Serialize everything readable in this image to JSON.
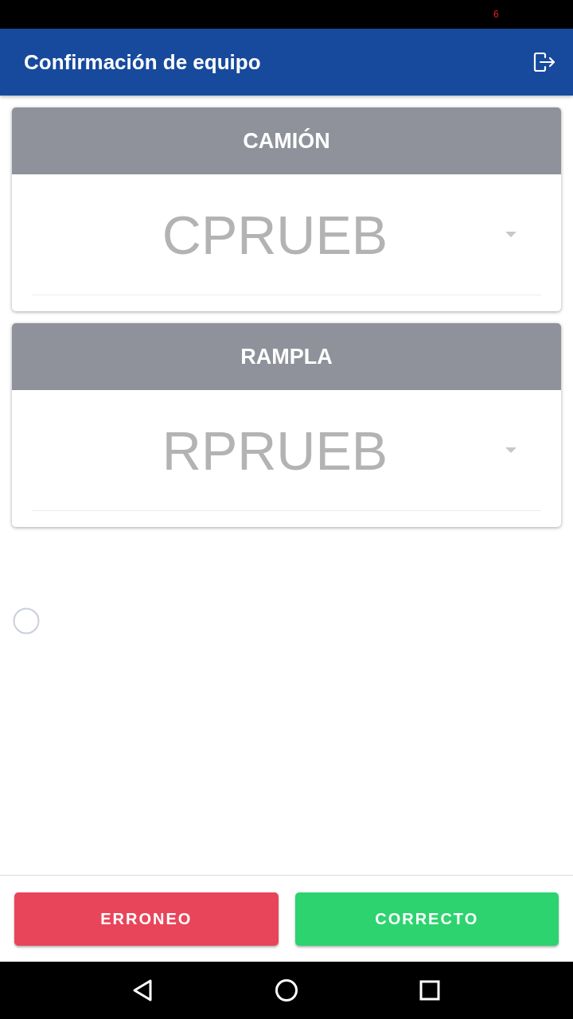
{
  "status_bar": {
    "indicator": "6"
  },
  "header": {
    "title": "Confirmación de equipo"
  },
  "cards": [
    {
      "title": "CAMIÓN",
      "value": "CPRUEB"
    },
    {
      "title": "RAMPLA",
      "value": "RPRUEB"
    }
  ],
  "buttons": [
    {
      "label": "ERRONEO",
      "kind": "danger"
    },
    {
      "label": "CORRECTO",
      "kind": "success"
    }
  ]
}
